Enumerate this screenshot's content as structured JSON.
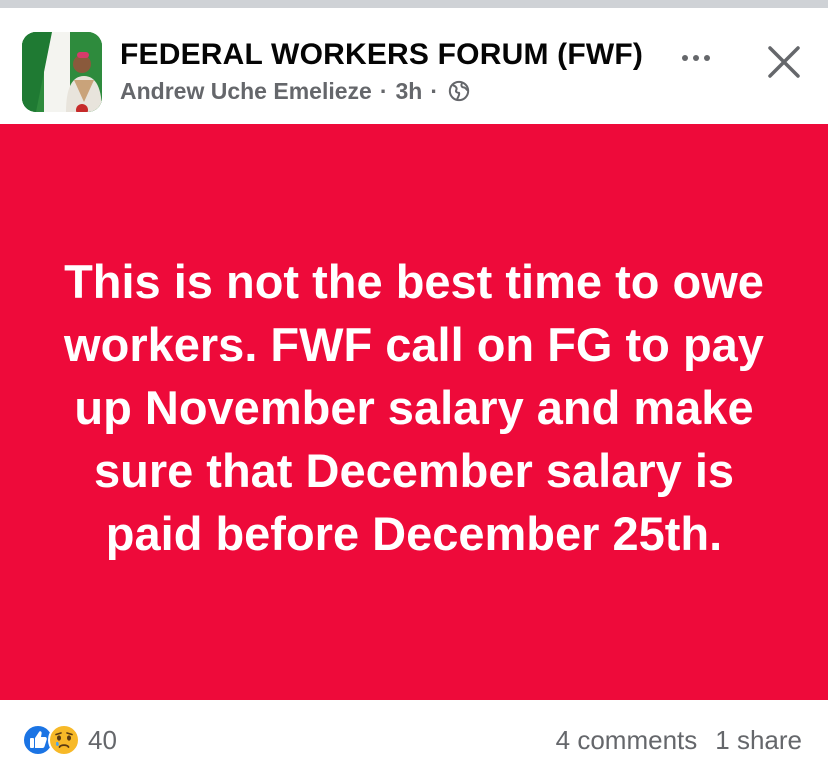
{
  "post": {
    "group_name": "FEDERAL WORKERS FORUM (FWF)",
    "author": "Andrew Uche Emelieze",
    "separator": "·",
    "time": "3h",
    "privacy_icon": "globe-icon",
    "more_icon": "more-options-icon",
    "close_icon": "close-icon",
    "background_color": "#ee0a3a",
    "text_color": "#ffffff",
    "message": "This is not the best time to owe workers. FWF call on FG to pay up  November salary and make sure that December salary is paid before December 25th."
  },
  "engagement": {
    "reaction_icons": [
      "like-icon",
      "sad-icon"
    ],
    "reaction_count": "40",
    "comments": "4 comments",
    "shares": "1 share"
  }
}
